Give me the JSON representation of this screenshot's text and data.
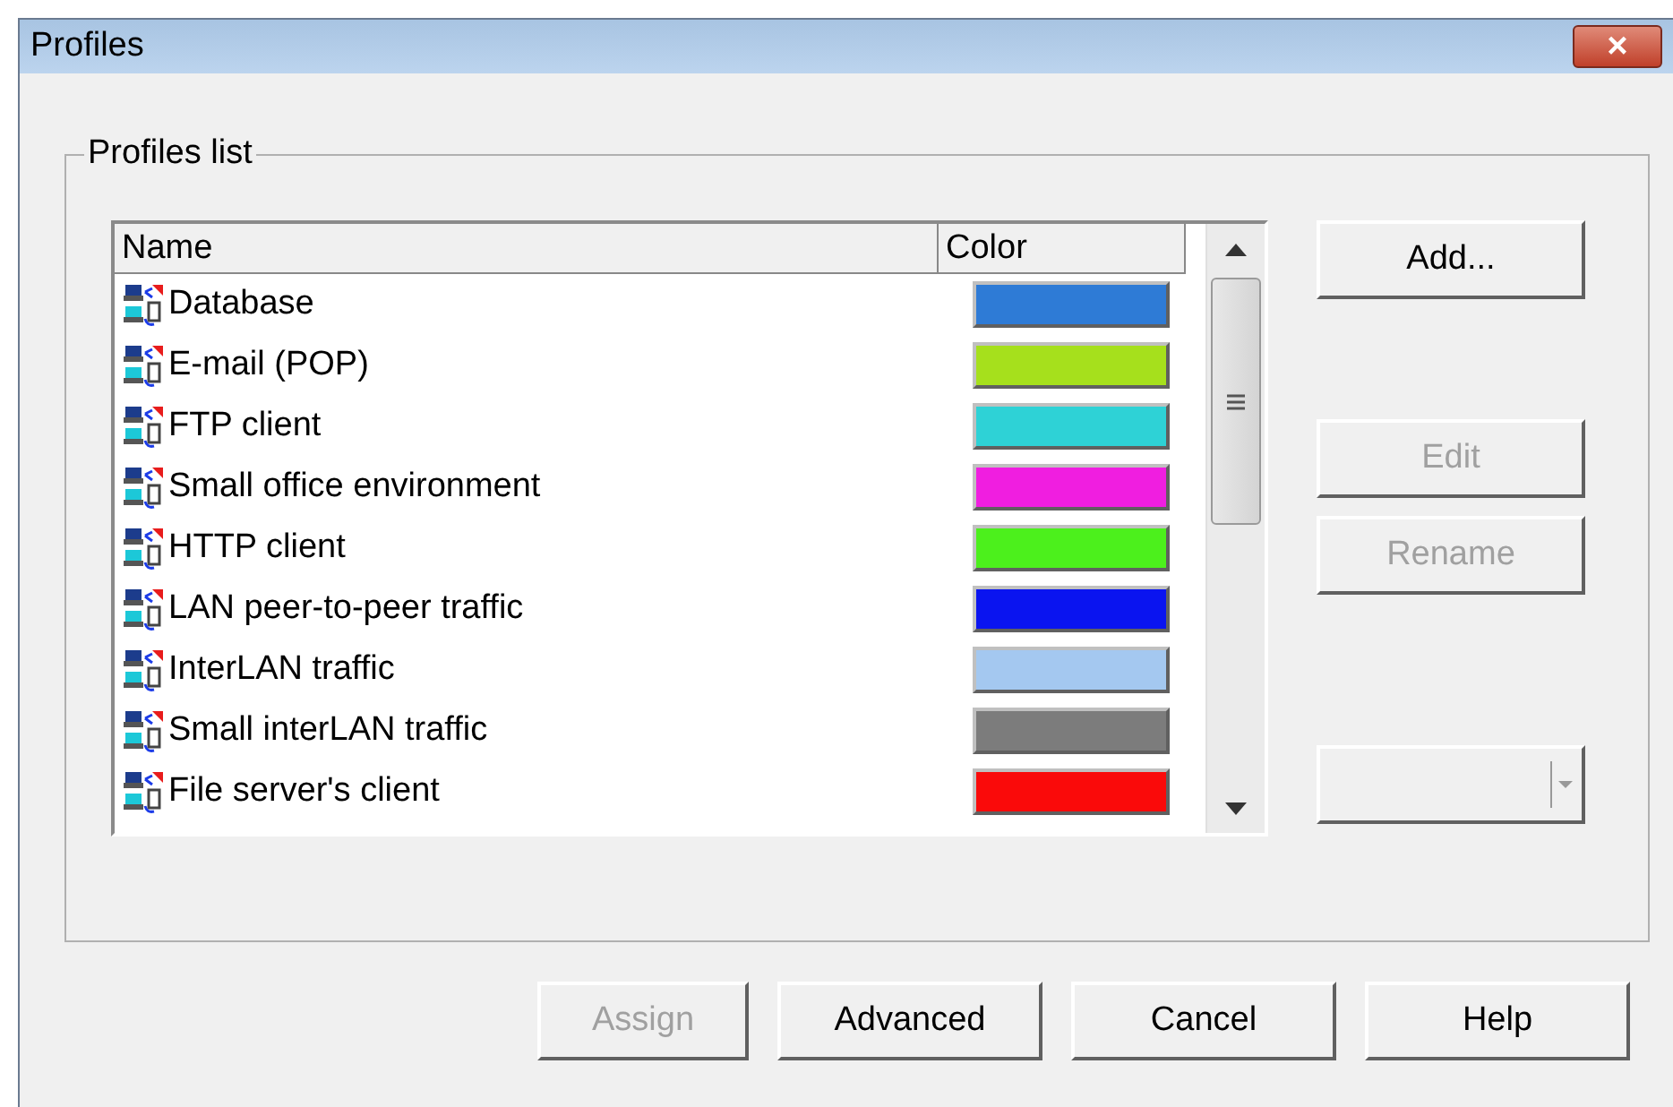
{
  "window": {
    "title": "Profiles",
    "close": "×"
  },
  "group": {
    "label": "Profiles list"
  },
  "list": {
    "columns": [
      "Name",
      "Color"
    ],
    "rows": [
      {
        "name": "Database",
        "color": "#2e7bd6"
      },
      {
        "name": "E-mail (POP)",
        "color": "#a6e01c"
      },
      {
        "name": "FTP client",
        "color": "#2ed2d6"
      },
      {
        "name": "Small office environment",
        "color": "#f01ee0"
      },
      {
        "name": "HTTP client",
        "color": "#4cf01c"
      },
      {
        "name": "LAN peer-to-peer traffic",
        "color": "#0a14f0"
      },
      {
        "name": "InterLAN traffic",
        "color": "#a4c8f0"
      },
      {
        "name": "Small interLAN traffic",
        "color": "#7c7c7c"
      },
      {
        "name": "File server's client",
        "color": "#fa0a0a"
      }
    ]
  },
  "side_buttons": [
    {
      "label": "Add...",
      "disabled": false
    },
    {
      "label": "Edit",
      "disabled": true
    },
    {
      "label": "Rename",
      "disabled": true
    }
  ],
  "combo": {
    "disabled": true
  },
  "buttons": [
    {
      "label": "Assign",
      "disabled": true
    },
    {
      "label": "Advanced",
      "disabled": false
    },
    {
      "label": "Cancel",
      "disabled": false
    },
    {
      "label": "Help",
      "disabled": false
    }
  ]
}
